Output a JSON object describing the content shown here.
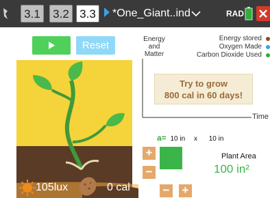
{
  "tabs": [
    {
      "label": "3.1",
      "state": "inactive"
    },
    {
      "label": "3.2",
      "state": "inactive"
    },
    {
      "label": "3.3",
      "state": "active"
    }
  ],
  "document_title": "*One_Giant..ind",
  "angle_mode": "RAD",
  "controls": {
    "play_icon": "play-icon",
    "reset_label": "Reset"
  },
  "legend": {
    "left_label": "Energy and Matter",
    "items": [
      {
        "label": "Energy stored",
        "color": "#8b4a2b"
      },
      {
        "label": "Oxygen Made",
        "color": "#3aa0e8"
      },
      {
        "label": "Carbon Dioxide Used",
        "color": "#2fae3a"
      }
    ]
  },
  "graph": {
    "x_axis_label": "Time"
  },
  "goal": {
    "line1": "Try to grow",
    "line2": "800 cal in 60 days!"
  },
  "dimensions": {
    "a_label": "a=",
    "width": "10 in",
    "times": "x",
    "height": "10 in"
  },
  "area": {
    "label": "Plant Area",
    "value": "100 in²"
  },
  "light": {
    "value": "105lux"
  },
  "calories": {
    "value": "0 cal"
  },
  "steppers": {
    "plus": "+",
    "minus": "−"
  },
  "colors": {
    "plant_green": "#3bb54a",
    "sky": "#f5d33a",
    "soil": "#5a3b26",
    "button_orange": "#e4a86b"
  }
}
